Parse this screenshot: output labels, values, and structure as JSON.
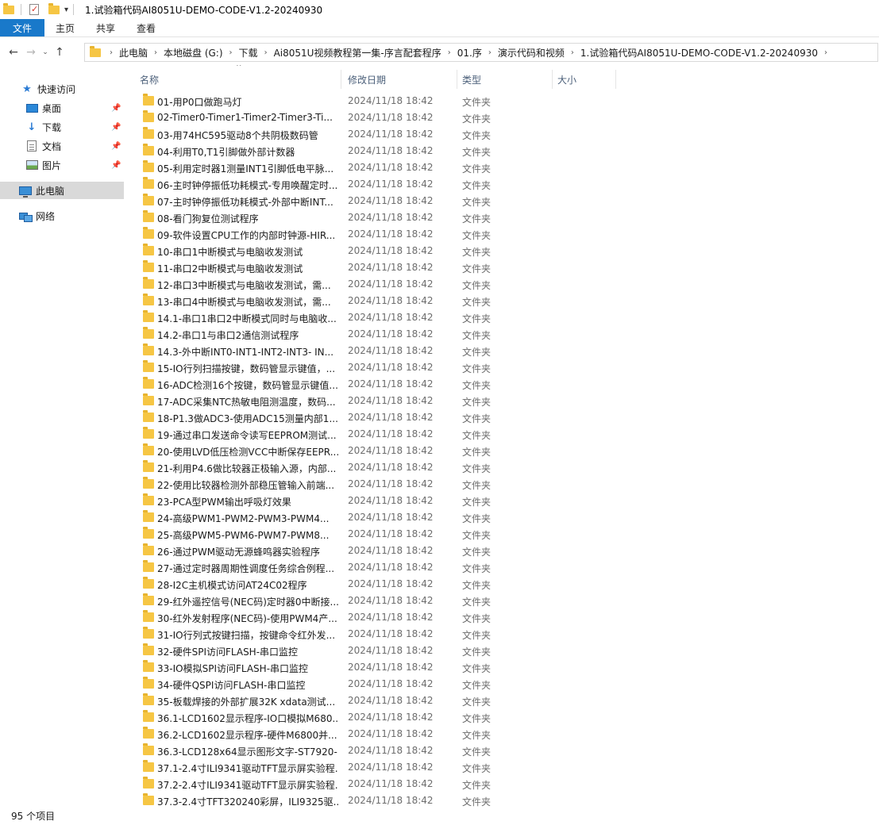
{
  "window": {
    "title": "1.试验箱代码AI8051U-DEMO-CODE-V1.2-20240930"
  },
  "ribbon": {
    "file": "文件",
    "home": "主页",
    "share": "共享",
    "view": "查看"
  },
  "address": {
    "crumbs": [
      "此电脑",
      "本地磁盘 (G:)",
      "下载",
      "Ai8051U视频教程第一集-序言配套程序",
      "01.序",
      "演示代码和视频",
      "1.试验箱代码AI8051U-DEMO-CODE-V1.2-20240930"
    ]
  },
  "sidebar": {
    "quick_access": "快速访问",
    "desktop": "桌面",
    "downloads": "下载",
    "documents": "文档",
    "pictures": "图片",
    "this_pc": "此电脑",
    "network": "网络"
  },
  "columns": {
    "name": "名称",
    "date": "修改日期",
    "type": "类型",
    "size": "大小"
  },
  "files": [
    {
      "name": "01-用P0口做跑马灯",
      "date": "2024/11/18 18:42",
      "type": "文件夹"
    },
    {
      "name": "02-Timer0-Timer1-Timer2-Timer3-Ti...",
      "date": "2024/11/18 18:42",
      "type": "文件夹"
    },
    {
      "name": "03-用74HC595驱动8个共阴极数码管",
      "date": "2024/11/18 18:42",
      "type": "文件夹"
    },
    {
      "name": "04-利用T0,T1引脚做外部计数器",
      "date": "2024/11/18 18:42",
      "type": "文件夹"
    },
    {
      "name": "05-利用定时器1测量INT1引脚低电平脉...",
      "date": "2024/11/18 18:42",
      "type": "文件夹"
    },
    {
      "name": "06-主时钟停振低功耗模式-专用唤醒定时...",
      "date": "2024/11/18 18:42",
      "type": "文件夹"
    },
    {
      "name": "07-主时钟停振低功耗模式-外部中断INT...",
      "date": "2024/11/18 18:42",
      "type": "文件夹"
    },
    {
      "name": "08-看门狗复位测试程序",
      "date": "2024/11/18 18:42",
      "type": "文件夹"
    },
    {
      "name": "09-软件设置CPU工作的内部时钟源-HIR...",
      "date": "2024/11/18 18:42",
      "type": "文件夹"
    },
    {
      "name": "10-串口1中断模式与电脑收发测试",
      "date": "2024/11/18 18:42",
      "type": "文件夹"
    },
    {
      "name": "11-串口2中断模式与电脑收发测试",
      "date": "2024/11/18 18:42",
      "type": "文件夹"
    },
    {
      "name": "12-串口3中断模式与电脑收发测试，需...",
      "date": "2024/11/18 18:42",
      "type": "文件夹"
    },
    {
      "name": "13-串口4中断模式与电脑收发测试，需...",
      "date": "2024/11/18 18:42",
      "type": "文件夹"
    },
    {
      "name": "14.1-串口1串口2中断模式同时与电脑收...",
      "date": "2024/11/18 18:42",
      "type": "文件夹"
    },
    {
      "name": "14.2-串口1与串口2通信测试程序",
      "date": "2024/11/18 18:42",
      "type": "文件夹"
    },
    {
      "name": "14.3-外中断INT0-INT1-INT2-INT3- IN...",
      "date": "2024/11/18 18:42",
      "type": "文件夹"
    },
    {
      "name": "15-IO行列扫描按键，数码管显示键值，...",
      "date": "2024/11/18 18:42",
      "type": "文件夹"
    },
    {
      "name": "16-ADC检测16个按键，数码管显示键值...",
      "date": "2024/11/18 18:42",
      "type": "文件夹"
    },
    {
      "name": "17-ADC采集NTC热敏电阻测温度，数码...",
      "date": "2024/11/18 18:42",
      "type": "文件夹"
    },
    {
      "name": "18-P1.3做ADC3-使用ADC15测量内部1....",
      "date": "2024/11/18 18:42",
      "type": "文件夹"
    },
    {
      "name": "19-通过串口发送命令读写EEPROM测试...",
      "date": "2024/11/18 18:42",
      "type": "文件夹"
    },
    {
      "name": "20-使用LVD低压检测VCC中断保存EEPR...",
      "date": "2024/11/18 18:42",
      "type": "文件夹"
    },
    {
      "name": "21-利用P4.6做比较器正极输入源，内部...",
      "date": "2024/11/18 18:42",
      "type": "文件夹"
    },
    {
      "name": "22-使用比较器检测外部稳压管输入前端...",
      "date": "2024/11/18 18:42",
      "type": "文件夹"
    },
    {
      "name": "23-PCA型PWM输出呼吸灯效果",
      "date": "2024/11/18 18:42",
      "type": "文件夹"
    },
    {
      "name": "24-高级PWM1-PWM2-PWM3-PWM4...",
      "date": "2024/11/18 18:42",
      "type": "文件夹"
    },
    {
      "name": "25-高级PWM5-PWM6-PWM7-PWM8...",
      "date": "2024/11/18 18:42",
      "type": "文件夹"
    },
    {
      "name": "26-通过PWM驱动无源蜂鸣器实验程序",
      "date": "2024/11/18 18:42",
      "type": "文件夹"
    },
    {
      "name": "27-通过定时器周期性调度任务综合例程...",
      "date": "2024/11/18 18:42",
      "type": "文件夹"
    },
    {
      "name": "28-I2C主机模式访问AT24C02程序",
      "date": "2024/11/18 18:42",
      "type": "文件夹"
    },
    {
      "name": "29-红外遥控信号(NEC码)定时器0中断接...",
      "date": "2024/11/18 18:42",
      "type": "文件夹"
    },
    {
      "name": "30-红外发射程序(NEC码)-使用PWM4产...",
      "date": "2024/11/18 18:42",
      "type": "文件夹"
    },
    {
      "name": "31-IO行列式按键扫描，按键命令红外发...",
      "date": "2024/11/18 18:42",
      "type": "文件夹"
    },
    {
      "name": "32-硬件SPI访问FLASH-串口监控",
      "date": "2024/11/18 18:42",
      "type": "文件夹"
    },
    {
      "name": "33-IO模拟SPI访问FLASH-串口监控",
      "date": "2024/11/18 18:42",
      "type": "文件夹"
    },
    {
      "name": "34-硬件QSPI访问FLASH-串口监控",
      "date": "2024/11/18 18:42",
      "type": "文件夹"
    },
    {
      "name": "35-板载焊接的外部扩展32K xdata测试...",
      "date": "2024/11/18 18:42",
      "type": "文件夹"
    },
    {
      "name": "36.1-LCD1602显示程序-IO口模拟M680...",
      "date": "2024/11/18 18:42",
      "type": "文件夹"
    },
    {
      "name": "36.2-LCD1602显示程序-硬件M6800并...",
      "date": "2024/11/18 18:42",
      "type": "文件夹"
    },
    {
      "name": "36.3-LCD128x64显示图形文字-ST7920-...",
      "date": "2024/11/18 18:42",
      "type": "文件夹"
    },
    {
      "name": "37.1-2.4寸ILI9341驱动TFT显示屏实验程...",
      "date": "2024/11/18 18:42",
      "type": "文件夹"
    },
    {
      "name": "37.2-2.4寸ILI9341驱动TFT显示屏实验程...",
      "date": "2024/11/18 18:42",
      "type": "文件夹"
    },
    {
      "name": "37.3-2.4寸TFT320240彩屏，ILI9325驱...",
      "date": "2024/11/18 18:42",
      "type": "文件夹"
    }
  ],
  "status": {
    "count": "95 个项目"
  }
}
